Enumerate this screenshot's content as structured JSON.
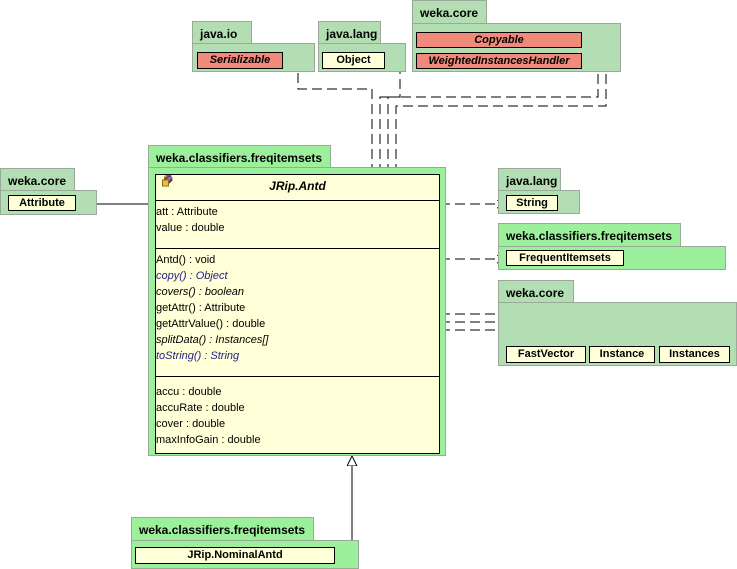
{
  "packages": {
    "java_io": {
      "name": "java.io",
      "classes": [
        "Serializable"
      ]
    },
    "java_lang_top": {
      "name": "java.lang",
      "classes": [
        "Object"
      ]
    },
    "weka_core_top": {
      "name": "weka.core",
      "classes": [
        "Copyable",
        "WeightedInstancesHandler"
      ]
    },
    "main": {
      "name": "weka.classifiers.freqitemsets"
    },
    "weka_core_left": {
      "name": "weka.core",
      "classes": [
        "Attribute"
      ]
    },
    "java_lang_right": {
      "name": "java.lang",
      "classes": [
        "String"
      ]
    },
    "freq_right": {
      "name": "weka.classifiers.freqitemsets",
      "classes": [
        "FrequentItemsets"
      ]
    },
    "weka_core_right": {
      "name": "weka.core",
      "classes": [
        "FastVector",
        "Instance",
        "Instances"
      ]
    },
    "freq_bottom": {
      "name": "weka.classifiers.freqitemsets",
      "classes": [
        "JRip.NominalAntd"
      ]
    }
  },
  "main_class": {
    "name": "JRip.Antd",
    "fields": [
      "att : Attribute",
      "value : double"
    ],
    "methods": [
      "Antd() : void",
      "copy() : Object",
      "covers() : boolean",
      "getAttr() : Attribute",
      "getAttrValue() : double",
      "splitData() : Instances[]",
      "toString() : String"
    ],
    "properties": [
      "accu : double",
      "accuRate : double",
      "cover : double",
      "maxInfoGain : double"
    ]
  },
  "colors": {
    "core_package": "#b3deb3",
    "freq_package": "#9cf09c",
    "class_fill": "#ffffd8",
    "interface_fill": "#f08a7a",
    "field_icon": "#7b7bea",
    "method_icon": "#c020c0"
  }
}
